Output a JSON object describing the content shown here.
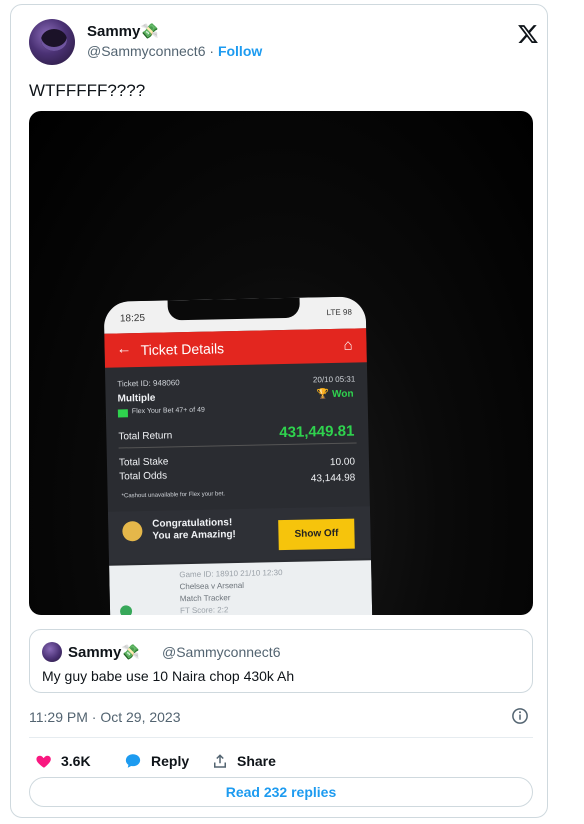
{
  "author": {
    "name": "Sammy",
    "name_emoji": "💸",
    "handle": "@Sammyconnect6",
    "separator": "·",
    "follow_label": "Follow"
  },
  "tweet": {
    "text": "WTFFFFF????"
  },
  "media": {
    "phone": {
      "status_time": "18:25",
      "status_network": "LTE",
      "status_battery": "98",
      "header_title": "Ticket Details",
      "ticket_id": "Ticket ID: 948060",
      "ticket_date": "20/10 05:31",
      "bet_type": "Multiple",
      "status": "Won",
      "flex_text": "Flex Your Bet 47+ of 49",
      "total_return_label": "Total Return",
      "total_return_value": "431,449.81",
      "total_stake_label": "Total Stake",
      "total_stake_value": "10.00",
      "total_odds_label": "Total Odds",
      "total_odds_value": "43,144.98",
      "cashout_note": "*Cashout unavailable for Flex your bet.",
      "promo_line1": "Congratulations!",
      "promo_line2": "You are Amazing!",
      "show_off_label": "Show Off",
      "game_id": "Game ID: 18910 21/10 12:30",
      "match": "Chelsea v Arsenal",
      "tracker": "Match Tracker",
      "ft_score": "FT Score: 2:2"
    }
  },
  "quote": {
    "name": "Sammy",
    "name_emoji": "💸",
    "handle": "@Sammyconnect6",
    "text": "My guy babe use 10 Naira chop 430k Ah"
  },
  "meta": {
    "timestamp": "11:29 PM · Oct 29, 2023"
  },
  "actions": {
    "likes": "3.6K",
    "reply_label": "Reply",
    "share_label": "Share"
  },
  "read_replies_label": "Read 232 replies",
  "colors": {
    "accent": "#1d9bf0",
    "like": "#f91880",
    "ticket_red": "#e3261f",
    "won_green": "#2fd34e"
  }
}
